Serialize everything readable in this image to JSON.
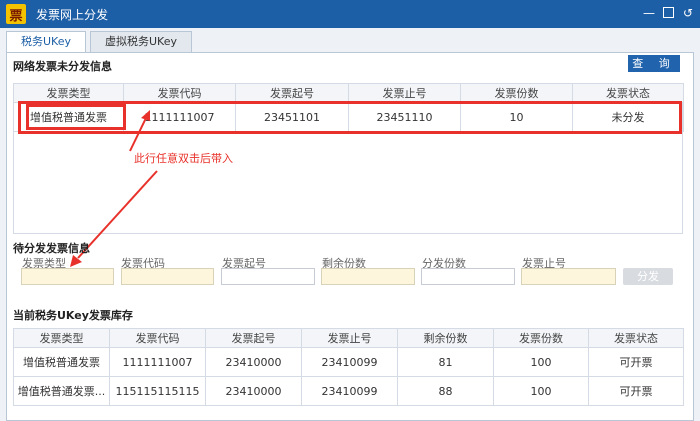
{
  "window": {
    "title": "发票网上分发",
    "logo_char": "票"
  },
  "tabs": [
    {
      "label": "税务UKey"
    },
    {
      "label": "虚拟税务UKey"
    }
  ],
  "network_section": {
    "title": "网络发票未分发信息",
    "query_button": "查 询",
    "columns": [
      "发票类型",
      "发票代码",
      "发票起号",
      "发票止号",
      "发票份数",
      "发票状态"
    ],
    "rows": [
      [
        "增值税普通发票",
        "1111111007",
        "23451101",
        "23451110",
        "10",
        "未分发"
      ]
    ]
  },
  "annotation": {
    "text": "此行任意双击后带入",
    "color": "#e8312a"
  },
  "pending_section": {
    "title": "待分发发票信息",
    "fields": [
      "发票类型",
      "发票代码",
      "发票起号",
      "剩余份数",
      "分发份数",
      "发票止号"
    ],
    "issue_button": "分发"
  },
  "inventory_section": {
    "title": "当前税务UKey发票库存",
    "columns": [
      "发票类型",
      "发票代码",
      "发票起号",
      "发票止号",
      "剩余份数",
      "发票份数",
      "发票状态"
    ],
    "rows": [
      [
        "增值税普通发票",
        "1111111007",
        "23410000",
        "23410099",
        "81",
        "100",
        "可开票"
      ],
      [
        "增值税普通发票...",
        "115115115115",
        "23410000",
        "23410099",
        "88",
        "100",
        "可开票"
      ]
    ]
  }
}
